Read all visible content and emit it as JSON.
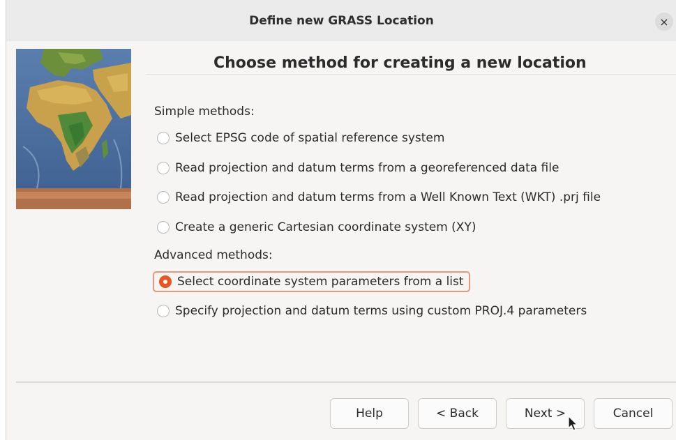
{
  "window": {
    "title": "Define new GRASS Location",
    "close_glyph": "×"
  },
  "heading": "Choose method for creating a new location",
  "simple": {
    "label": "Simple methods:",
    "options": [
      "Select EPSG code of spatial reference system",
      "Read projection and datum terms from a georeferenced data file",
      "Read projection and datum terms from a Well Known Text (WKT) .prj file",
      "Create a generic Cartesian coordinate system (XY)"
    ]
  },
  "advanced": {
    "label": "Advanced methods:",
    "options": [
      "Select coordinate system parameters from a list",
      "Specify projection and datum terms using custom PROJ.4 parameters"
    ],
    "selected_index": 0
  },
  "buttons": {
    "help": "Help",
    "back": "< Back",
    "next": "Next >",
    "cancel": "Cancel"
  },
  "colors": {
    "accent": "#e95420",
    "focus_ring": "#e9967a"
  }
}
